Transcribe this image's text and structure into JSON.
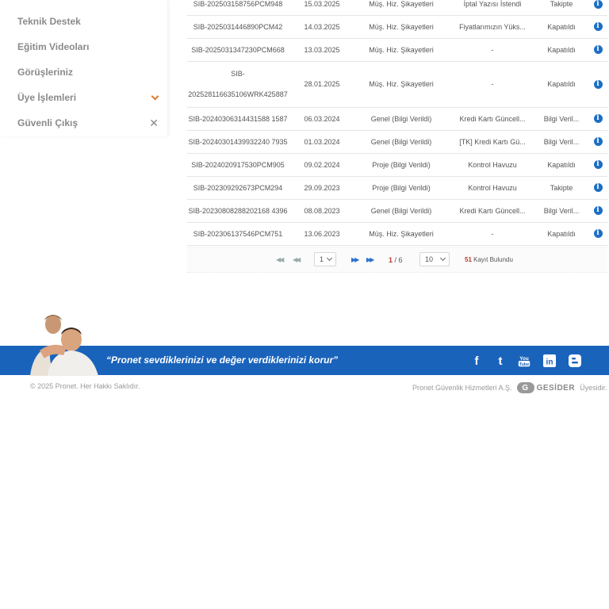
{
  "sidebar": {
    "items": [
      {
        "label": "Teknik Destek"
      },
      {
        "label": "Eğitim Videoları"
      },
      {
        "label": "Görüşleriniz"
      },
      {
        "label": "Üye İşlemleri"
      },
      {
        "label": "Güvenli Çıkış"
      }
    ]
  },
  "table": {
    "rows": [
      {
        "no": "SIB-202503158756PCM948",
        "date": "15.03.2025",
        "category": "Müş. Hiz. Şikayetleri",
        "subject": "İptal Yazısı İstendi",
        "status": "Takipte"
      },
      {
        "no": "SIB-2025031446890PCM42",
        "date": "14.03.2025",
        "category": "Müş. Hiz. Şikayetleri",
        "subject": "Fiyatlarımızın Yüks...",
        "status": "Kapatıldı"
      },
      {
        "no": "SIB-2025031347230PCM668",
        "date": "13.03.2025",
        "category": "Müş. Hiz. Şikayetleri",
        "subject": "-",
        "status": "Kapatıldı"
      },
      {
        "no_line1": "SIB-",
        "no_line2": "202528116635106WRK425887",
        "date": "28.01.2025",
        "category": "Müş. Hiz. Şikayetleri",
        "subject": "-",
        "status": "Kapatıldı"
      },
      {
        "no": "SIB-20240306314431588 1587",
        "date": "06.03.2024",
        "category": "Genel (Bilgi Verildi)",
        "subject": "Kredi Kartı Güncell...",
        "status": "Bilgi Veril..."
      },
      {
        "no": "SIB-20240301439932240 7935",
        "date": "01.03.2024",
        "category": "Genel (Bilgi Verildi)",
        "subject": "[TK] Kredi Kartı Gü...",
        "status": "Bilgi Veril..."
      },
      {
        "no": "SIB-2024020917530PCM905",
        "date": "09.02.2024",
        "category": "Proje (Bilgi Verildi)",
        "subject": "Kontrol Havuzu",
        "status": "Kapatıldı"
      },
      {
        "no": "SIB-202309292673PCM294",
        "date": "29.09.2023",
        "category": "Proje (Bilgi Verildi)",
        "subject": "Kontrol Havuzu",
        "status": "Takipte"
      },
      {
        "no": "SIB-20230808288202168 4396",
        "date": "08.08.2023",
        "category": "Genel (Bilgi Verildi)",
        "subject": "Kredi Kartı Güncell...",
        "status": "Bilgi Veril..."
      },
      {
        "no": "SIB-202306137546PCM751",
        "date": "13.06.2023",
        "category": "Müş. Hiz. Şikayetleri",
        "subject": "-",
        "status": "Kapatıldı"
      }
    ]
  },
  "pager": {
    "page_select": "1",
    "current_page": "1",
    "total_pages": "/ 6",
    "page_size": "10",
    "record_count": "51",
    "record_label": "Kayıt Bulundu"
  },
  "footer": {
    "slogan": "“Pronet sevdiklerinizi ve değer verdiklerinizi korur”",
    "copyright": "© 2025 Pronet. Her Hakkı Saklıdır.",
    "member_prefix": "Pronet Güvenlik Hizmetleri A.Ş.",
    "gesider": "GESİDER",
    "member_suffix": "Üyesidir."
  },
  "colors": {
    "accent_blue": "#1a63bb",
    "chevron_orange": "#e07a2a",
    "count_red": "#c0392b"
  }
}
